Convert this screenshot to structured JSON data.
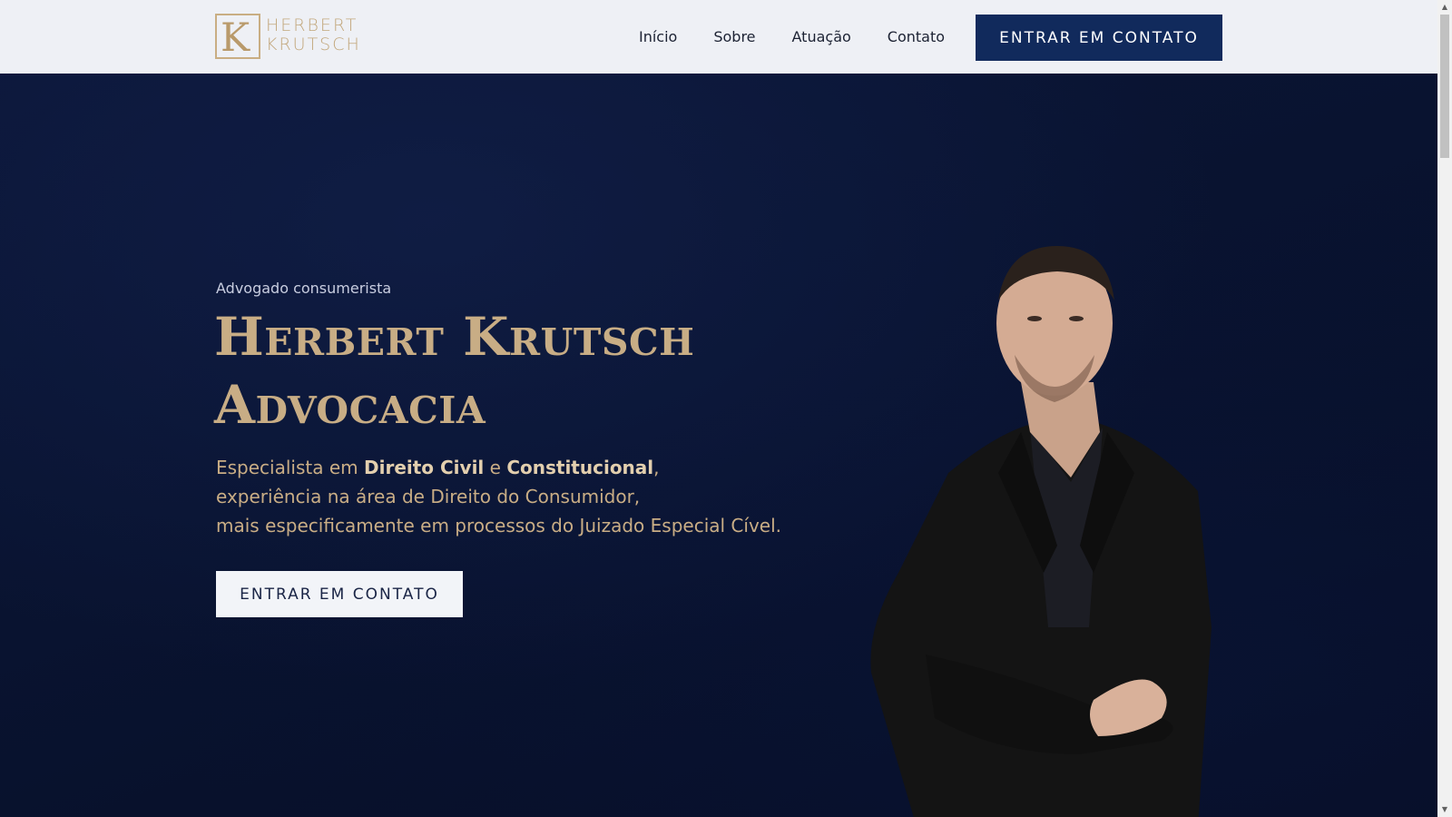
{
  "header": {
    "logo_letter": "K",
    "logo_line1": "HERBERT",
    "logo_line2": "KRUTSCH",
    "nav": {
      "inicio": "Início",
      "sobre": "Sobre",
      "atuacao": "Atuação",
      "contato": "Contato"
    },
    "cta_label": "ENTRAR EM CONTATO"
  },
  "hero": {
    "kicker": "Advogado consumerista",
    "title_line1": "Herbert Krutsch",
    "title_line2": "Advocacia",
    "desc": {
      "p1_a": "Especialista em ",
      "p1_b": "Direito Civil",
      "p1_c": " e ",
      "p1_d": "Constitucional",
      "p1_e": ",",
      "line2": "experiência na área de Direito do Consumidor,",
      "line3": "mais especificamente em processos do Juizado Especial Cível."
    },
    "cta_label": "ENTRAR EM CONTATO"
  },
  "colors": {
    "gold": "#c8ad85",
    "navy_button": "#112a5c",
    "hero_bg": "#091330"
  },
  "icons": {
    "scroll_up": "triangle-up-icon",
    "scroll_down": "triangle-down-icon"
  }
}
